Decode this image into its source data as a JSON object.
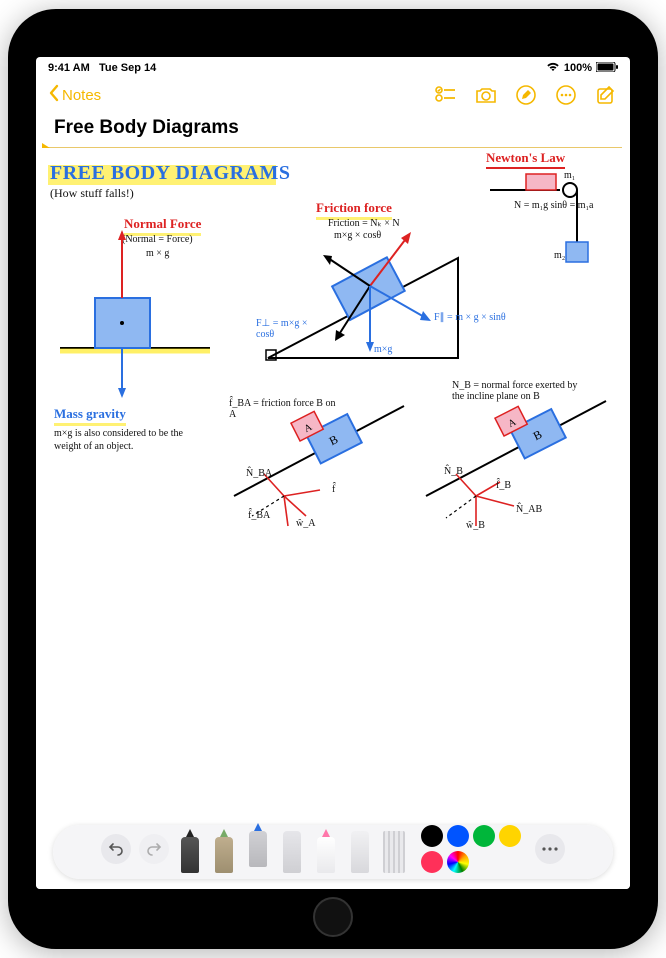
{
  "status": {
    "time": "9:41 AM",
    "date": "Tue Sep 14",
    "battery": "100%"
  },
  "toolbar": {
    "back": "Notes"
  },
  "note": {
    "title": "Free Body Diagrams"
  },
  "sketch": {
    "heading": "FREE BODY DIAGRAMS",
    "subheading": "(How stuff falls!)",
    "normal_force_label": "Normal Force",
    "normal_force_eq1": "(Normal = Force)",
    "normal_force_eq2": "m × g",
    "mass_gravity_label": "Mass gravity",
    "mass_gravity_note": "m×g is also considered to be the weight of an object.",
    "friction_label": "Friction force",
    "friction_eq1": "Friction = Nₖ × N",
    "friction_eq2": "m×g × cosθ",
    "friction_ft": "F⊥ = m×g × cosθ",
    "friction_fpar": "F∥ = m × g × sinθ",
    "friction_mxg": "m×g",
    "newton_label": "Newton's Law",
    "newton_m1": "m₁",
    "newton_m2": "m₂",
    "newton_eq": "N = m₁g sinθ = m₁a",
    "incline_fba": "f̂_BA = friction force B on A",
    "incline_A": "A",
    "incline_B": "B",
    "incline_nb_note": "N_B = normal force exerted by the incline plane on B",
    "vec_nba": "N̂_BA",
    "vec_fba": "f̂_BA",
    "vec_wa": "ŵ_A",
    "vec_f": "f̂",
    "vec_nb": "N̂_B",
    "vec_fb": "f̂_B",
    "vec_wb": "ŵ_B",
    "vec_nab": "N̂_AB"
  },
  "draw_toolbar": {
    "tools": [
      "pen",
      "pencil",
      "marker",
      "eraser-slim",
      "crayon",
      "eraser",
      "ruler"
    ],
    "selected": 2,
    "colors": [
      "#000000",
      "#0054ff",
      "#00b63a",
      "#ffd400",
      "#ff3059",
      "rainbow"
    ]
  }
}
